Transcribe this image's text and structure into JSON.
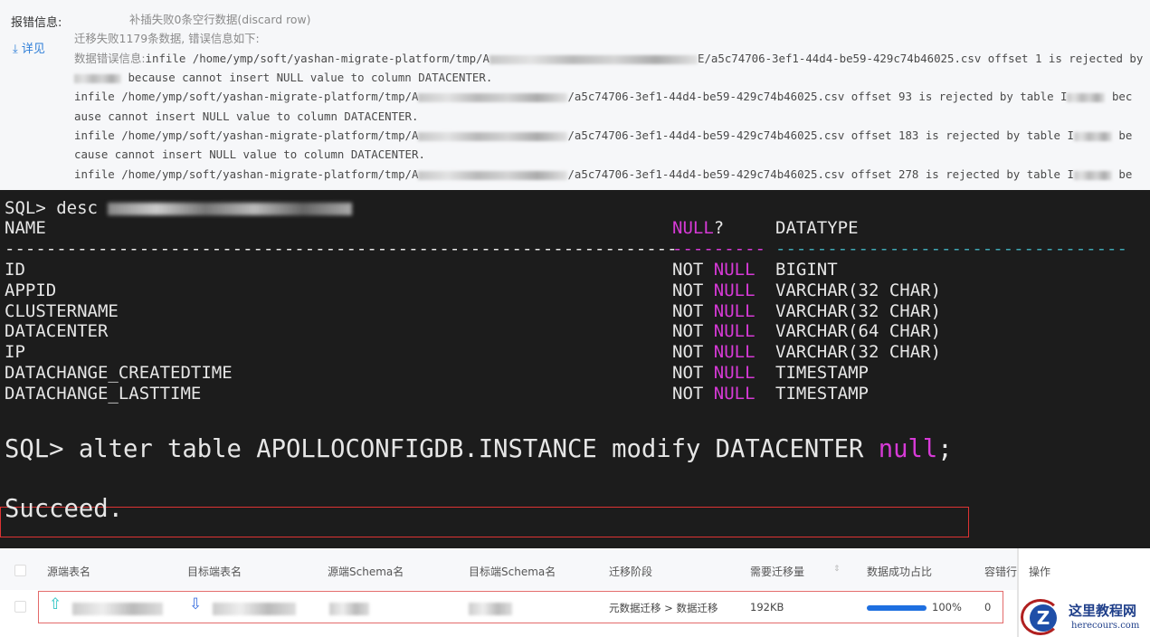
{
  "error_panel": {
    "label": "报错信息:",
    "details_link": "详见",
    "line0": "补插失败0条空行数据(discard row)",
    "line1": "迁移失败1179条数据, 错误信息如下:",
    "line2_prefix": "数据错误信息:",
    "line2_a": "infile /home/ymp/soft/yashan-migrate-platform/tmp/A",
    "line2_b": "E/a5c74706-3ef1-44d4-be59-429c74b46025.csv offset 1 is rejected by table I",
    "line3": " because cannot insert NULL value to column DATACENTER.",
    "line4_a": "infile /home/ymp/soft/yashan-migrate-platform/tmp/A",
    "line4_b": "/a5c74706-3ef1-44d4-be59-429c74b46025.csv offset 93 is rejected by table I",
    "line4_c": " bec",
    "line5": "ause cannot insert NULL value to column DATACENTER.",
    "line6_a": "infile /home/ymp/soft/yashan-migrate-platform/tmp/A",
    "line6_b": "/a5c74706-3ef1-44d4-be59-429c74b46025.csv offset 183 is rejected by table I",
    "line6_c": " be",
    "line7": "cause cannot insert NULL value to column DATACENTER.",
    "line8_a": "infile /home/ymp/soft/yashan-migrate-platform/tmp/A",
    "line8_b": "/a5c74706-3ef1-44d4-be59-429c74b46025.csv offset 278 is rejected by table I",
    "line8_c": " be"
  },
  "terminal": {
    "desc_cmd": "SQL> desc ",
    "col_name": "NAME",
    "col_null": "NULL",
    "col_null_q": "?",
    "col_type": "DATATYPE",
    "sep_name": "-----------------------------------------------------------------",
    "sep_null": "---------",
    "sep_type": "----------------------------------",
    "not": "NOT ",
    "null_kw": "NULL",
    "rows": [
      {
        "name": "ID",
        "type": "BIGINT"
      },
      {
        "name": "APPID",
        "type": "VARCHAR(32 CHAR)"
      },
      {
        "name": "CLUSTERNAME",
        "type": "VARCHAR(32 CHAR)"
      },
      {
        "name": "DATACENTER",
        "type": "VARCHAR(64 CHAR)"
      },
      {
        "name": "IP",
        "type": "VARCHAR(32 CHAR)"
      },
      {
        "name": "DATACHANGE_CREATEDTIME",
        "type": "TIMESTAMP"
      },
      {
        "name": "DATACHANGE_LASTTIME",
        "type": "TIMESTAMP"
      }
    ],
    "alter_cmd": "SQL> alter table APOLLOCONFIGDB.INSTANCE modify DATACENTER ",
    "alter_null": "null",
    "alter_end": ";",
    "result": "Succeed."
  },
  "table": {
    "headers": [
      "源端表名",
      "目标端表名",
      "源端Schema名",
      "目标端Schema名",
      "迁移阶段",
      "需要迁移量",
      "数据成功占比",
      "容错行",
      "操作"
    ],
    "row": {
      "stage": "元数据迁移 > 数据迁移",
      "size": "192KB",
      "success_percent": 100,
      "success_label": "100%",
      "error_rows": "0"
    },
    "accent": "#1e6fe0"
  },
  "watermark": {
    "name": "这里教程网",
    "domain": "herecours.com"
  }
}
